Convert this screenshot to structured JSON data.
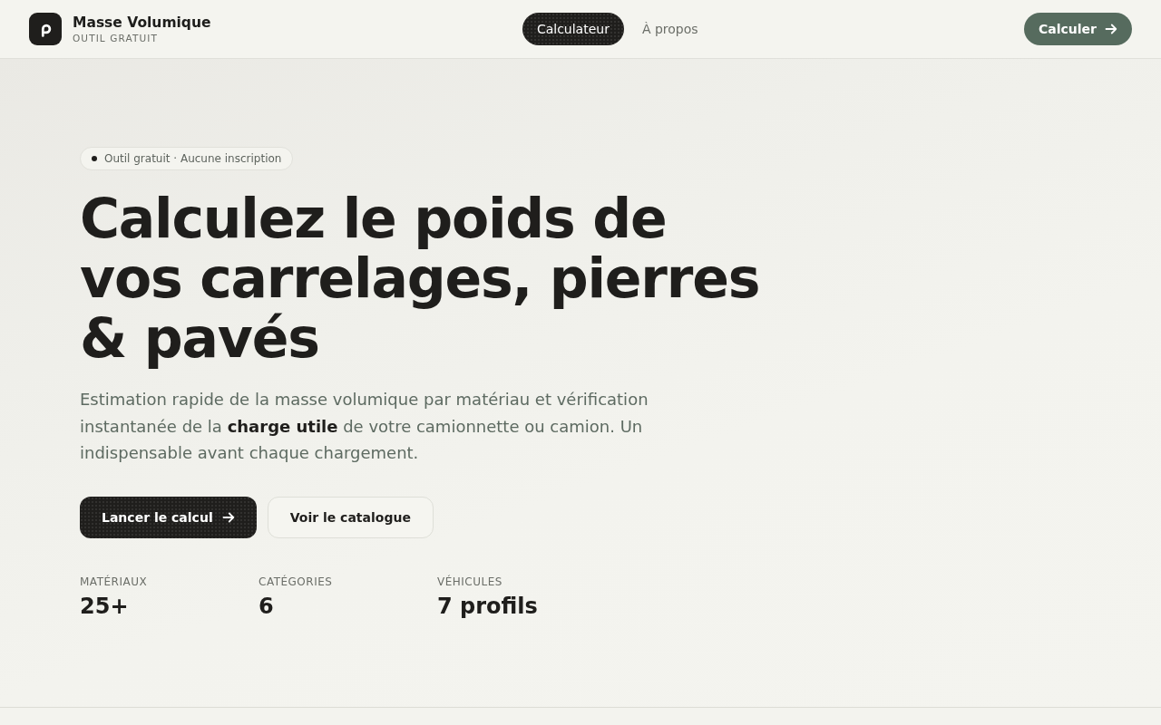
{
  "header": {
    "brand": {
      "title": "Masse Volumique",
      "subtitle": "OUTIL GRATUIT"
    },
    "nav": [
      {
        "label": "Calculateur",
        "selected": true
      },
      {
        "label": "À propos",
        "selected": false
      }
    ],
    "cta": {
      "label": "Calculer"
    }
  },
  "hero": {
    "badge": "Outil gratuit · Aucune inscription",
    "headline": "Calculez le poids de vos carrelages, pierres & pavés",
    "lead": "Estimation rapide de la masse volumique par matériau et vérification instantanée de la **charge utile** de votre camionnette ou camion. Un indispensable avant chaque chargement.",
    "buttons": [
      {
        "label": "Lancer le calcul",
        "kind": "primary"
      },
      {
        "label": "Voir le catalogue",
        "kind": "secondary"
      }
    ],
    "stats": [
      {
        "label": "MATÉRIAUX",
        "value": "25+"
      },
      {
        "label": "CATÉGORIES",
        "value": "6"
      },
      {
        "label": "VÉHICULES",
        "value": "7 profils"
      }
    ]
  }
}
